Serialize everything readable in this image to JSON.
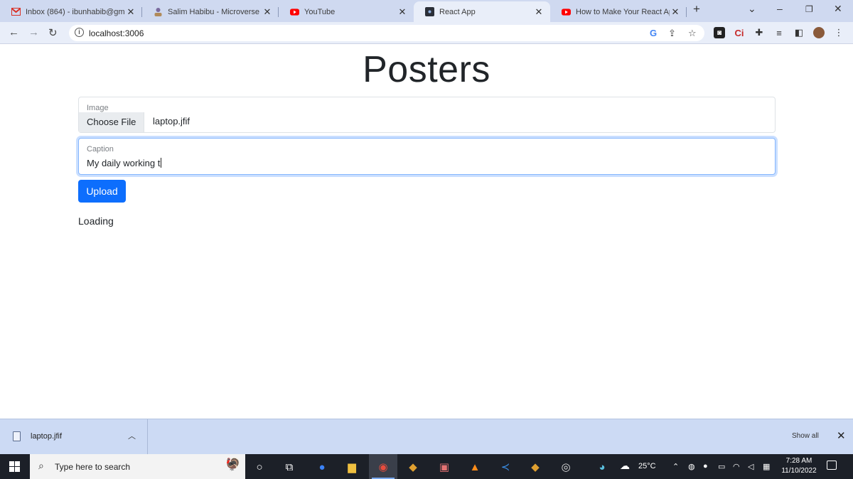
{
  "browser": {
    "tabs": [
      {
        "title": "Inbox (864) - ibunhabib@gm",
        "icon": "gmail-icon"
      },
      {
        "title": "Salim Habibu - Microverse St",
        "icon": "person-icon"
      },
      {
        "title": "YouTube",
        "icon": "youtube-icon"
      },
      {
        "title": "React App",
        "icon": "react-app-icon",
        "active": true
      },
      {
        "title": "How to Make Your React Ap",
        "icon": "youtube-icon"
      }
    ],
    "new_tab_glyph": "+",
    "url": "localhost:3006"
  },
  "page": {
    "title": "Posters",
    "image_field": {
      "label": "Image",
      "button_label": "Choose File",
      "file_name": "laptop.jfif"
    },
    "caption_field": {
      "label": "Caption",
      "value": "My daily working t"
    },
    "upload_label": "Upload",
    "status_text": "Loading"
  },
  "downloads": {
    "file_name": "laptop.jfif",
    "show_all_label": "Show all"
  },
  "taskbar": {
    "search_placeholder": "Type here to search",
    "weather": "25°C",
    "time": "7:28 AM",
    "date": "11/10/2022"
  },
  "colors": {
    "primary": "#0d6efd",
    "tabstrip": "#cfd9f0",
    "toolbar": "#e9eef9",
    "shelf": "#ccdaf4",
    "taskbar": "#1c2028"
  }
}
